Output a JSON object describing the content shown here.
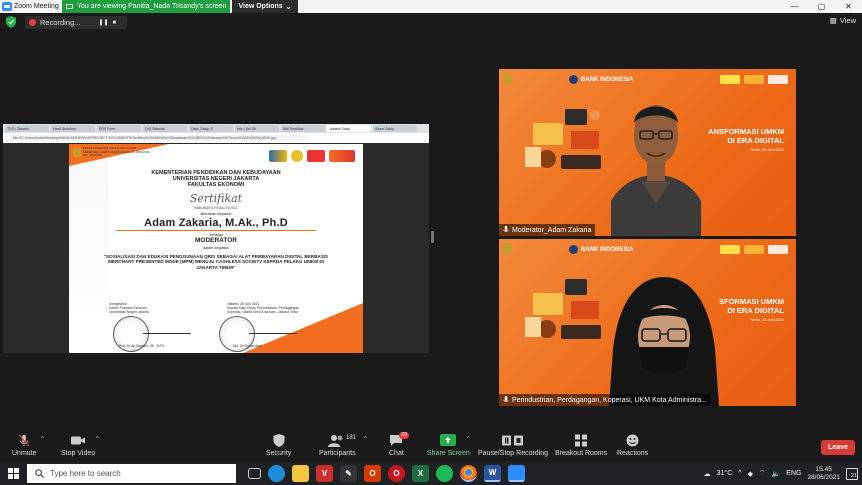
{
  "window": {
    "title": "Zoom Meeting",
    "share_banner": "You are viewing Panitia_Nada Trisandy's screen",
    "view_options": "View Options",
    "recording": "Recording...",
    "view": "View"
  },
  "browser": {
    "tabs": [
      "TDS | Zakaria",
      "Hasil Unduhan",
      "SDS Form",
      "(14) Sekolah",
      "Data_Sakip_P",
      "Info | Uni Sk",
      "Bali Sertifikat",
      "Jakarta Sakip",
      "Adam Sakip"
    ],
    "url": "file:///C:/Users/Indah/Desktop/NADA%20NEW%20PROJECT/DOCUMENTS/Sertifikat%20UMKM%20Sosialisasi%20QRIS%20Jakarta%20Timur/ADAM%20ZAKARIA.jpg"
  },
  "certificate": {
    "ministry_header": "DINAS KOPERASI USAHA KECIL DAN MENENGAH SERTA PERDAGANGAN PROVINSI DKI JAKARTA",
    "line1": "KEMENTERIAN PENDIDIKAN DAN KEBUDAYAAN",
    "line2": "UNIVERSITAS NEGERI JAKARTA",
    "line3": "FAKULTAS EKONOMI",
    "title": "Sertifikat",
    "number": "948/UN39.5.FE/DL/VI/2021",
    "given_to": "diberikan kepada:",
    "name": "Adam Zakaria, M.Ak., Ph.D",
    "as": "sebagai",
    "role": "MODERATOR",
    "activity": "dalam kegiatan",
    "description": "\"SOSIALISASI DAN EDUKASI PENGGUNAAN QRIS SEBAGAI ALAT PEMBAYARAN DIGITAL BERBASIS MERCHANT PRESENTED MODE (MPM) MENUJU CASHLESS SOCIETY KEPADA PELAKU UMKM DI JAKARTA TIMUR\"",
    "left_sig_title": "Mengetahui,\nDekan Fakultas Ekonomi\nUniversitas Negeri Jakarta",
    "left_sig_name": "Prof. Dr. Ari Saptono, SE., M.Pd",
    "right_sig_title": "Jakarta, 28 Juni 2021\nKepala Suku Dinas Perindustrian, Perdagangan,\nKoperasi, Usaha Kecil Kota Adm. Jakarta Timur",
    "right_sig_name": "Dra. Sri Suparmiyati"
  },
  "tiles": [
    {
      "bank": "BANK INDONESIA",
      "banner": "ANSFORMASI UMKM\nDI ERA DIGITAL",
      "date": "Senin, 28 Juni 2021",
      "name": "Moderator_Adam Zakaria"
    },
    {
      "bank": "BANK INDONESIA",
      "banner": "SFORMASI UMKM\nDI ERA DIGITAL",
      "date": "Senin, 28 Juni 2021",
      "name": "Perindustrian, Perdagangan, Koperasi, UKM Kota Administra..."
    }
  ],
  "toolbar": {
    "unmute": "Unmute",
    "stop_video": "Stop Video",
    "security": "Security",
    "participants": "Participants",
    "participants_count": "181",
    "chat": "Chat",
    "chat_badge": "20",
    "share_screen": "Share Screen",
    "recording": "Pause/Stop Recording",
    "breakout": "Breakout Rooms",
    "reactions": "Reactions",
    "leave": "Leave"
  },
  "taskbar": {
    "search_placeholder": "Type here to search",
    "weather": "31°C",
    "lang": "ENG",
    "time": "15.45",
    "date": "28/06/2021",
    "notifications": "21"
  },
  "colors": {
    "accent_green": "#1e9e3e",
    "brand_orange": "#f0751f",
    "leave_red": "#d63b35"
  }
}
